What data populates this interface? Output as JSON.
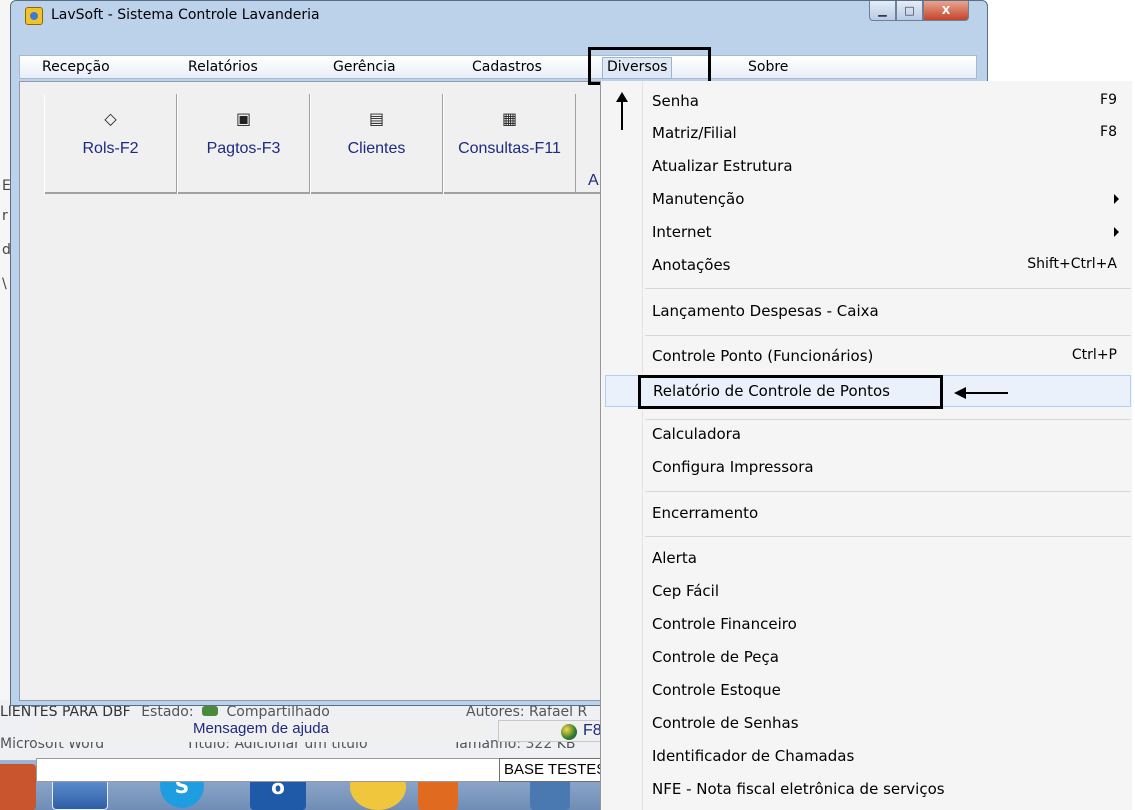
{
  "window": {
    "title": "LavSoft - Sistema Controle Lavanderia",
    "controls": {
      "minimize": "▁",
      "maximize": "□",
      "close": "X"
    }
  },
  "menubar": {
    "items": [
      "Recepção",
      "Relatórios",
      "Gerência",
      "Cadastros",
      "Diversos",
      "Sobre"
    ],
    "active": "Diversos"
  },
  "toolbar": {
    "buttons": [
      {
        "label": "Rols-F2",
        "icon": "book-icon"
      },
      {
        "label": "Pagtos-F3",
        "icon": "printer-icon"
      },
      {
        "label": "Clientes",
        "icon": "document-icon"
      },
      {
        "label": "Consultas-F11",
        "icon": "calculator-icon"
      }
    ],
    "partial_label": "A"
  },
  "statusbar": {
    "help_message": "Mensagem de ajuda",
    "f8_label": "F8",
    "base_label": "BASE TESTES"
  },
  "dropdown": {
    "items": [
      {
        "label": "Senha",
        "shortcut": "F9"
      },
      {
        "label": "Matriz/Filial",
        "shortcut": "F8"
      },
      {
        "label": "Atualizar Estrutura",
        "shortcut": ""
      },
      {
        "label": "Manutenção",
        "shortcut": "",
        "submenu": true
      },
      {
        "label": "Internet",
        "shortcut": "",
        "submenu": true
      },
      {
        "label": "Anotações",
        "shortcut": "Shift+Ctrl+A"
      },
      {
        "label": "Lançamento Despesas - Caixa",
        "shortcut": ""
      },
      {
        "label": "Controle Ponto (Funcionários)",
        "shortcut": "Ctrl+P"
      },
      {
        "label": "Relatório de Controle de Pontos",
        "shortcut": "",
        "highlighted": true
      },
      {
        "label": "Calculadora",
        "shortcut": ""
      },
      {
        "label": "Configura Impressora",
        "shortcut": ""
      },
      {
        "label": "Encerramento",
        "shortcut": ""
      },
      {
        "label": "Alerta",
        "shortcut": ""
      },
      {
        "label": "Cep Fácil",
        "shortcut": ""
      },
      {
        "label": "Controle Financeiro",
        "shortcut": ""
      },
      {
        "label": "Controle de Peça",
        "shortcut": ""
      },
      {
        "label": "Controle Estoque",
        "shortcut": ""
      },
      {
        "label": "Controle de Senhas",
        "shortcut": ""
      },
      {
        "label": "Identificador de Chamadas",
        "shortcut": ""
      },
      {
        "label": "NFE - Nota fiscal eletrônica de serviços",
        "shortcut": ""
      }
    ]
  },
  "background": {
    "left_fragments": [
      "E",
      "r",
      "d",
      "\\"
    ],
    "details_row1": {
      "name": "LIENTES PARA DBF",
      "state_label": "Estado:",
      "state_value": "Compartilhado",
      "authors_label": "Autores:",
      "authors_value": "Rafael R"
    },
    "details_row2": {
      "type": "Microsoft Word",
      "title_label": "Título:",
      "title_value": "Adicionar um título",
      "size_label": "Tamanho:",
      "size_value": "322 KB"
    },
    "taskbar_icons": [
      "windows-explorer-icon",
      "skype-icon",
      "outlook-icon",
      "media-icon",
      "calculator-icon",
      "app-icon"
    ],
    "taskbar_glyphs": [
      "S",
      "o"
    ]
  }
}
